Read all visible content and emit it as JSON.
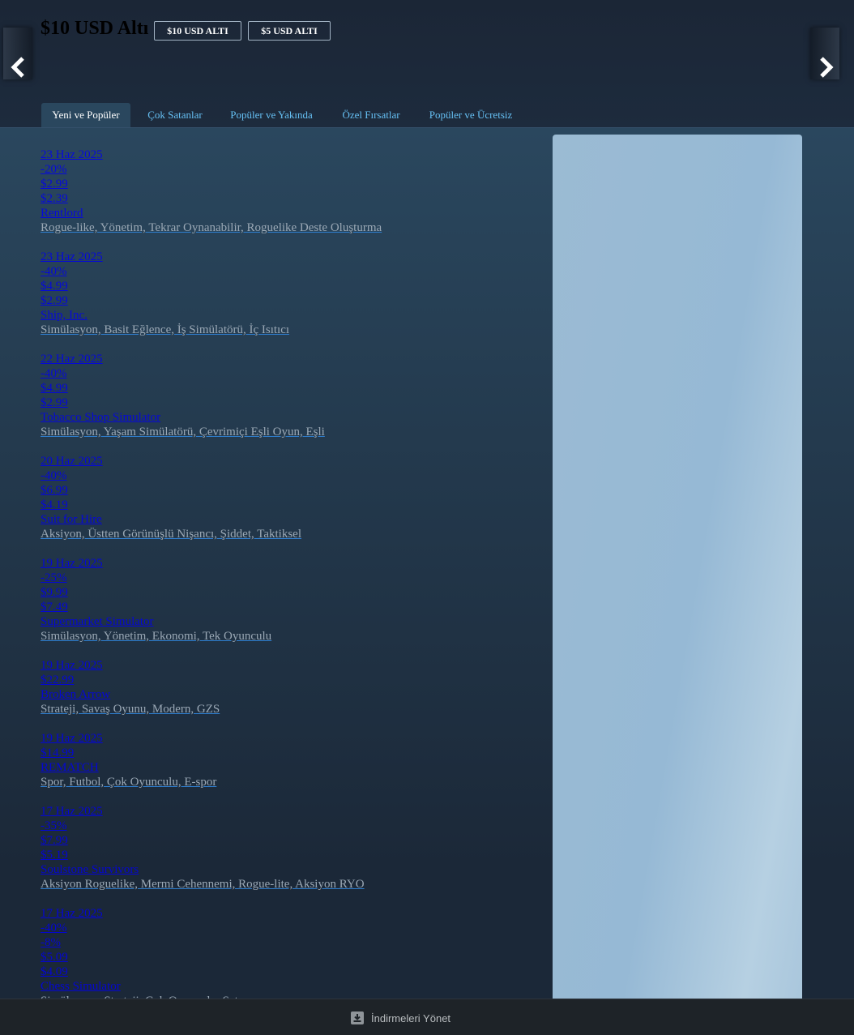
{
  "header": {
    "title": "$10 USD Altı",
    "filters": [
      "$10 USD ALTI",
      "$5 USD ALTI"
    ]
  },
  "tabs": [
    {
      "label": "Yeni ve Popüler",
      "active": true
    },
    {
      "label": "Çok Satanlar",
      "active": false
    },
    {
      "label": "Popüler ve Yakında",
      "active": false
    },
    {
      "label": "Özel Fırsatlar",
      "active": false
    },
    {
      "label": "Popüler ve Ücretsiz",
      "active": false
    }
  ],
  "games": [
    {
      "date": "23 Haz 2025",
      "discount": "-20%",
      "original_price": "$2.99",
      "final_price": "$2.39",
      "name": "Rentlord",
      "tags": "Rogue-like, Yönetim, Tekrar Oynanabilir, Roguelike Deste Oluşturma"
    },
    {
      "date": "23 Haz 2025",
      "discount": "-40%",
      "original_price": "$4.99",
      "final_price": "$2.99",
      "name": "Ship, Inc.",
      "tags": "Simülasyon, Basit Eğlence, İş Simülatörü, İç Isıtıcı"
    },
    {
      "date": "22 Haz 2025",
      "discount": "-40%",
      "original_price": "$4.99",
      "final_price": "$2.99",
      "name": "Tobacco Shop Simulator",
      "tags": "Simülasyon, Yaşam Simülatörü, Çevrimiçi Eşli Oyun, Eşli"
    },
    {
      "date": "20 Haz 2025",
      "discount": "-40%",
      "original_price": "$6.99",
      "final_price": "$4.19",
      "name": "Suit for Hire",
      "tags": "Aksiyon, Üstten Görünüşlü Nişancı, Şiddet, Taktiksel"
    },
    {
      "date": "19 Haz 2025",
      "discount": "-25%",
      "original_price": "$9.99",
      "final_price": "$7.49",
      "name": "Supermarket Simulator",
      "tags": "Simülasyon, Yönetim, Ekonomi, Tek Oyunculu"
    },
    {
      "date": "19 Haz 2025",
      "price": "$22.99",
      "name": "Broken Arrow",
      "tags": "Strateji, Savaş Oyunu, Modern, GZS"
    },
    {
      "date": "19 Haz 2025",
      "price": "$14.99",
      "name": "REMATCH",
      "tags": "Spor, Futbol, Çok Oyunculu, E-spor"
    },
    {
      "date": "17 Haz 2025",
      "discount": "-35%",
      "original_price": "$7.99",
      "final_price": "$5.19",
      "name": "Soulstone Survivors",
      "tags": "Aksiyon Roguelike, Mermi Cehennemi, Rogue-lite, Aksiyon RYO"
    },
    {
      "date": "17 Haz 2025",
      "discount": "-40%",
      "extra": "-8%",
      "original_price": "$5.09",
      "final_price": "$4.09",
      "name": "Chess Simulator",
      "tags": "Simülasyon, Strateji, Çok Oyunculu, Satranç"
    }
  ],
  "bottom_bar": {
    "label": "İndirmeleri Yönet",
    "icon": "download-icon"
  },
  "colors": {
    "background": "#1b2838",
    "tab_active_bg": "#2a475e",
    "link_blue": "#0000ee",
    "tab_text": "#66c0f4"
  }
}
